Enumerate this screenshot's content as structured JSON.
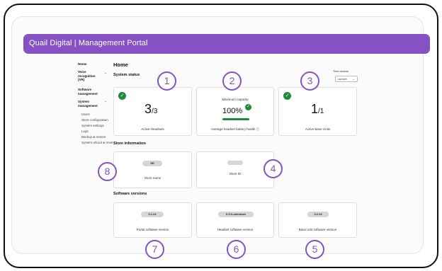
{
  "app": {
    "title": "Quail Digital | Management Portal"
  },
  "sidebar": {
    "home": "Home",
    "voice": "Voice recognition (VR)",
    "voice_chev": "⌄",
    "software": "Software management",
    "system": "System management",
    "system_chev": "⌃",
    "sub_items": [
      "Users",
      "Store configuration",
      "System settings",
      "Logs",
      "Backup & restore",
      "System reboot & reset"
    ]
  },
  "page": {
    "title": "Home"
  },
  "system_status": {
    "title": "System status",
    "time_window_label": "Time window",
    "time_window_value": "current",
    "headsets": {
      "value": "3",
      "total": "/3",
      "caption": "Active Headsets"
    },
    "battery": {
      "label": "Maximum capacity",
      "value": "100%",
      "caption": "Average headset battery health ⓘ",
      "fill": 1.0
    },
    "base_units": {
      "value": "1",
      "total": "/1",
      "caption": "Active Base Units"
    }
  },
  "store_info": {
    "title": "Store information",
    "store_name": {
      "value": "SD",
      "caption": "Store name"
    },
    "store_id": {
      "value": "",
      "caption": "Store ID"
    }
  },
  "software_versions": {
    "title": "Software versions",
    "portal": {
      "value": "0.1.22",
      "caption": "Portal software version"
    },
    "headset": {
      "value": "0.0.0-unknown",
      "caption": "Headset software version"
    },
    "base_unit": {
      "value": "0.2.13",
      "caption": "Base Unit software version"
    }
  },
  "badges": [
    "1",
    "2",
    "3",
    "4",
    "5",
    "6",
    "7",
    "8"
  ],
  "colors": {
    "brand": "#8551c4",
    "success": "#1e8a3a"
  }
}
